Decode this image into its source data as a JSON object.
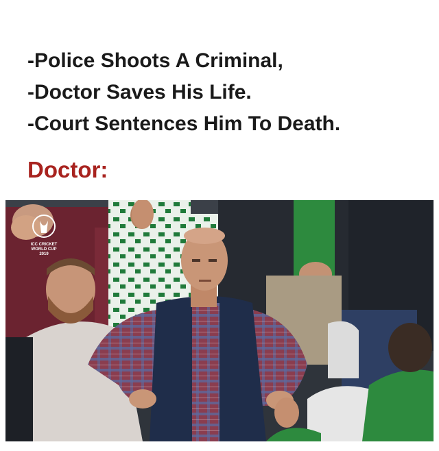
{
  "meme": {
    "lines": [
      "-Police Shoots A Criminal,",
      "-Doctor Saves His Life.",
      "-Court Sentences Him To Death."
    ],
    "punchline": "Doctor:",
    "punchline_color": "#a8231f"
  },
  "photo": {
    "logo_text": "ICC CRICKET WORLD CUP 2019",
    "scene": "disappointed-fan-in-crowd"
  }
}
